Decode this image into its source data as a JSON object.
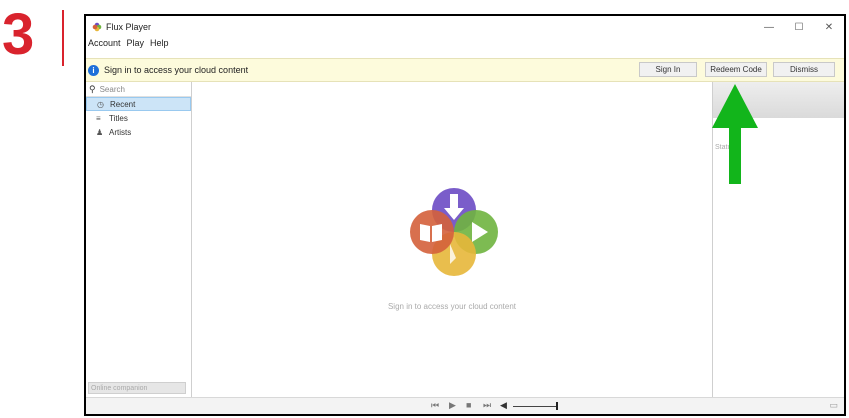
{
  "step": {
    "number": "3"
  },
  "window": {
    "title": "Flux Player",
    "controls": {
      "minimize": "—",
      "maximize": "☐",
      "close": "✕"
    }
  },
  "menu": {
    "items": [
      "Account",
      "Play",
      "Help"
    ]
  },
  "notification": {
    "icon": "info-icon",
    "text": "Sign in to access your cloud content",
    "sign_in_label": "Sign In",
    "redeem_label": "Redeem Code",
    "dismiss_label": "Dismiss"
  },
  "sidebar": {
    "search_placeholder": "Search",
    "items": [
      {
        "label": "Recent",
        "icon": "clock-icon"
      },
      {
        "label": "Titles",
        "icon": "list-icon"
      },
      {
        "label": "Artists",
        "icon": "person-icon"
      }
    ],
    "footer": "Online companion"
  },
  "main": {
    "empty_message": "Sign in to access your cloud content"
  },
  "right_panel": {
    "status": "Status:"
  },
  "player": {
    "controls": [
      "skip-back-icon",
      "play-icon",
      "stop-icon",
      "skip-forward-icon",
      "volume-icon"
    ]
  },
  "overlay": {
    "arrow_color": "#12b51b",
    "accent_red": "#d9232d"
  }
}
